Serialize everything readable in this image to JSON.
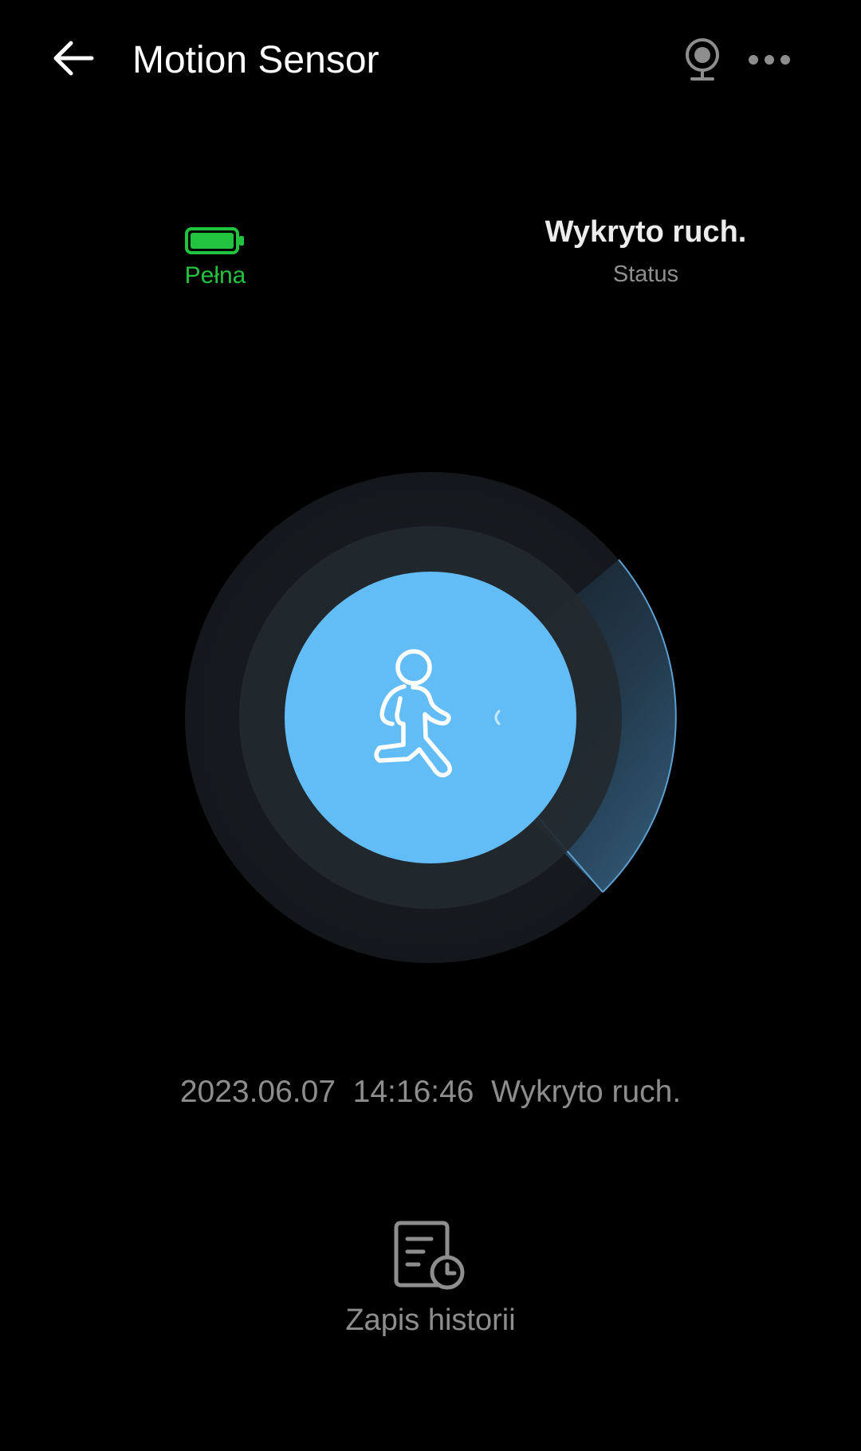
{
  "header": {
    "title": "Motion Sensor",
    "back_icon": "arrow-left-icon",
    "camera_icon": "webcam-icon",
    "more_icon": "more-horizontal-icon"
  },
  "battery": {
    "icon": "battery-full-icon",
    "label": "Pełna",
    "level": 1.0,
    "color": "#22c33f"
  },
  "status": {
    "value": "Wykryto ruch.",
    "label": "Status"
  },
  "radar": {
    "icon": "walking-person-icon",
    "accent_color": "#62bdf7"
  },
  "last_event": {
    "date": "2023.06.07",
    "time": "14:16:46",
    "text": "Wykryto ruch.",
    "display": "2023.06.07  14:16:46  Wykryto ruch."
  },
  "history": {
    "icon": "history-log-icon",
    "label": "Zapis historii"
  }
}
